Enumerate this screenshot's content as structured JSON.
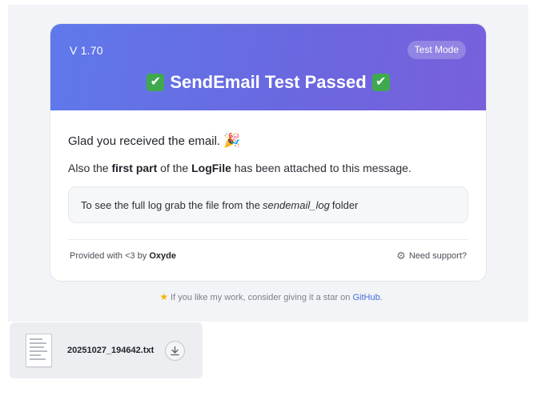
{
  "email": {
    "version": "V 1.70",
    "badge": "Test Mode",
    "headline": "SendEmail Test Passed",
    "greeting": "Glad you received the email.",
    "attach_line": {
      "prefix": "Also the ",
      "bold1": "first part",
      "middle": " of the ",
      "bold2": "LogFile",
      "suffix": " has been attached to this message."
    },
    "info": {
      "prefix": "To see the full log grab the file from the",
      "folder": "sendemail_log",
      "suffix": "folder"
    },
    "footer": {
      "provided_prefix": "Provided with <3 by ",
      "author": "Oxyde",
      "support": "Need support?"
    },
    "star_note": {
      "text": " If you like my work, consider giving it a star on ",
      "link": "GitHub",
      "end": "."
    }
  },
  "attachment": {
    "filename": "20251027_194642.txt",
    "icon": "text-file-icon",
    "action_icon": "download-icon"
  },
  "colors": {
    "header_start": "#5f79ea",
    "header_end": "#7860db",
    "check_green": "#3fa94d",
    "link": "#3f6fd8"
  }
}
